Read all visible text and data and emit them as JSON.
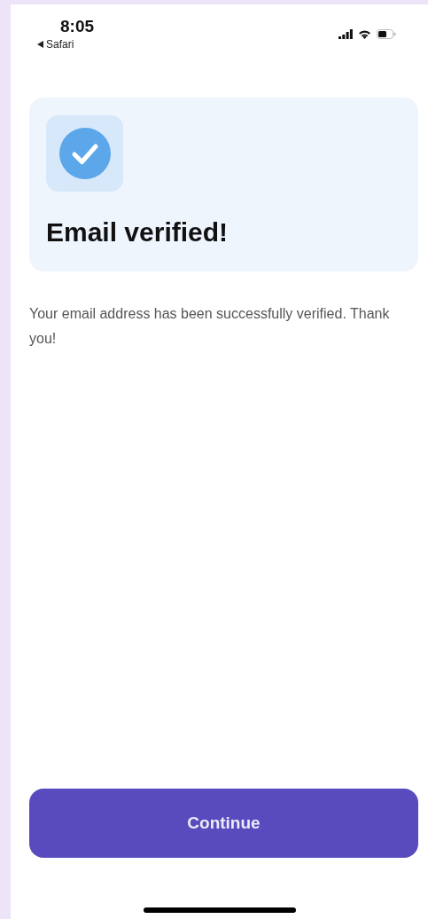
{
  "status_bar": {
    "time": "8:05",
    "back_label": "Safari"
  },
  "card": {
    "title": "Email verified!"
  },
  "message": "Your email address has been successfully verified. Thank you!",
  "primary_button": {
    "label": "Continue"
  }
}
